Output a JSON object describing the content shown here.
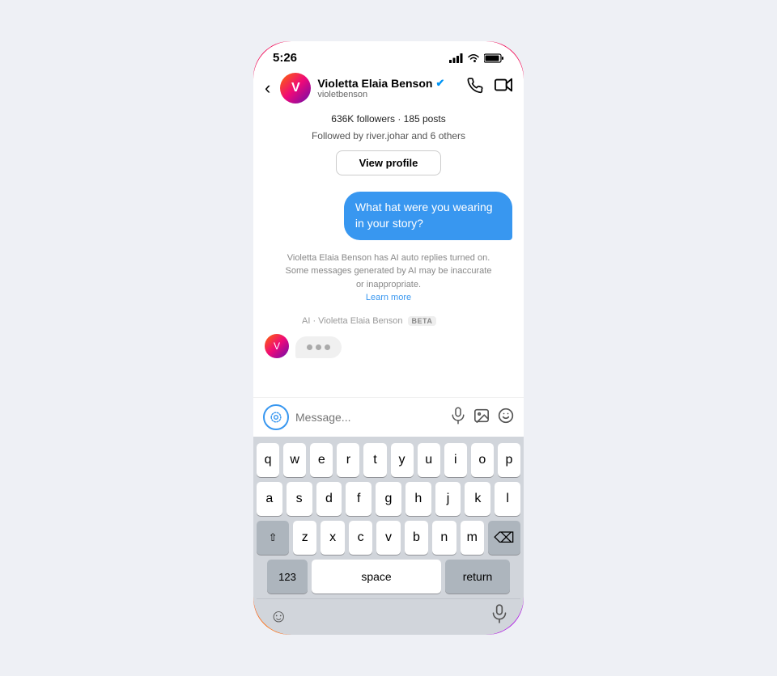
{
  "status_bar": {
    "time": "5:26"
  },
  "header": {
    "back_label": "‹",
    "user_name": "Violetta Elaia Benson",
    "username": "violetbenson",
    "verified": "✓",
    "phone_icon": "📞",
    "video_icon": "📹"
  },
  "profile": {
    "stats": "636K followers · 185 posts",
    "followed_by": "Followed by river.johar and 6 others",
    "view_profile_label": "View profile"
  },
  "chat": {
    "outgoing_message": "What hat were you wearing in your story?",
    "ai_notice": "Violetta Elaia Benson has AI auto replies turned on. Some messages generated by AI may be inaccurate or inappropriate.",
    "learn_more": "Learn more",
    "ai_label": "AI · Violetta Elaia Benson",
    "beta": "BETA"
  },
  "input": {
    "placeholder": "Message...",
    "mic_icon": "🎤",
    "image_icon": "🖼",
    "sticker_icon": "😊"
  },
  "keyboard": {
    "row1": [
      "q",
      "w",
      "e",
      "r",
      "t",
      "y",
      "u",
      "i",
      "o",
      "p"
    ],
    "row2": [
      "a",
      "s",
      "d",
      "f",
      "g",
      "h",
      "j",
      "k",
      "l"
    ],
    "row3": [
      "z",
      "x",
      "c",
      "v",
      "b",
      "n",
      "m"
    ],
    "num_label": "123",
    "space_label": "space",
    "return_label": "return"
  },
  "keyboard_bottom": {
    "emoji_icon": "😊",
    "mic_icon": "🎤"
  }
}
